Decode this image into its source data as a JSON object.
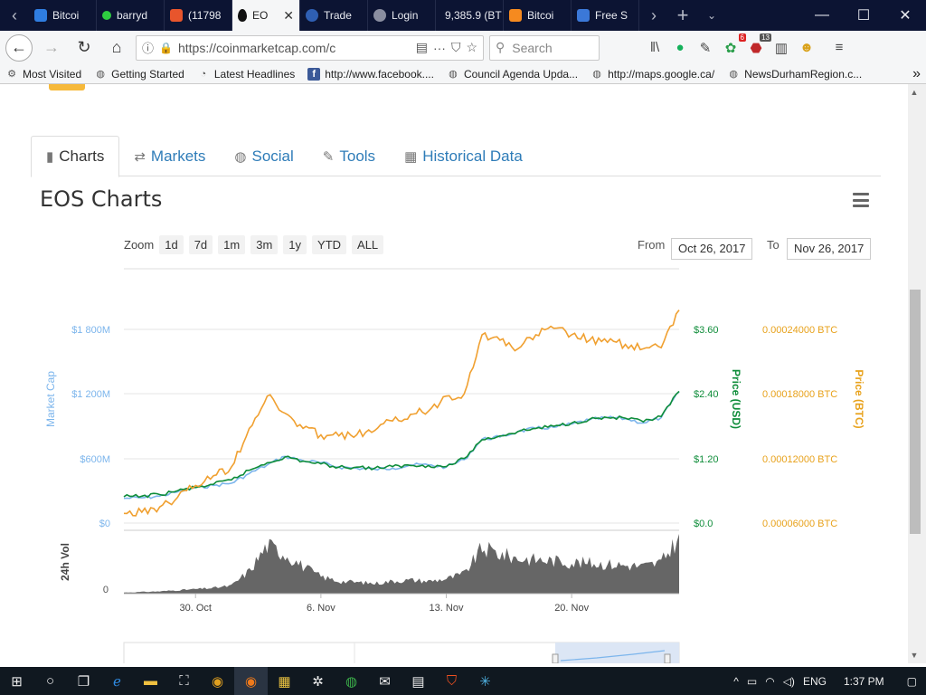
{
  "browser": {
    "tabs": [
      {
        "label": "Bitcoi",
        "icon": "wallet-icon",
        "color": "#2f7de1"
      },
      {
        "label": "barryd",
        "icon": "status-dot-icon",
        "color": "#2ecc40"
      },
      {
        "label": "(11798",
        "icon": "chat-icon",
        "color": "#e8552c"
      },
      {
        "label": "EO",
        "icon": "eos-icon",
        "color": "#111111",
        "active": true
      },
      {
        "label": "Trade",
        "icon": "coin-icon",
        "color": "#2f5fb3"
      },
      {
        "label": "Login",
        "icon": "lock-icon",
        "color": "#8a8ea0"
      },
      {
        "label": "9,385.9 (BT",
        "icon": "",
        "color": ""
      },
      {
        "label": "Bitcoi",
        "icon": "chart-icon",
        "color": "#f58a1f"
      },
      {
        "label": "Free S",
        "icon": "mail-icon",
        "color": "#3b78d8"
      }
    ],
    "url": "https://coinmarketcap.com/c",
    "search_placeholder": "Search",
    "badges": {
      "extension_a": "6",
      "extension_b": "13"
    },
    "bookmarks": [
      {
        "label": "Most Visited",
        "icon": "gear-icon"
      },
      {
        "label": "Getting Started",
        "icon": "globe-icon"
      },
      {
        "label": "Latest Headlines",
        "icon": "rss-icon"
      },
      {
        "label": "http://www.facebook....",
        "icon": "facebook-icon"
      },
      {
        "label": "Council Agenda Upda...",
        "icon": "globe-icon"
      },
      {
        "label": "http://maps.google.ca/",
        "icon": "globe-icon"
      },
      {
        "label": "NewsDurhamRegion.c...",
        "icon": "globe-icon"
      }
    ]
  },
  "page": {
    "tabs": [
      {
        "label": "Charts",
        "icon": "bar-chart-icon",
        "active": true
      },
      {
        "label": "Markets",
        "icon": "exchange-icon"
      },
      {
        "label": "Social",
        "icon": "globe-icon"
      },
      {
        "label": "Tools",
        "icon": "wrench-icon"
      },
      {
        "label": "Historical Data",
        "icon": "calendar-icon"
      }
    ],
    "chart_title": "EOS Charts",
    "zoom_label": "Zoom",
    "zoom_options": [
      "1d",
      "7d",
      "1m",
      "3m",
      "1y",
      "YTD",
      "ALL"
    ],
    "from_label": "From",
    "from_date": "Oct 26, 2017",
    "to_label": "To",
    "to_date": "Nov 26, 2017"
  },
  "chart_data": {
    "type": "line",
    "title": "EOS Charts",
    "x": [
      "Oct 26",
      "Oct 27",
      "Oct 28",
      "Oct 29",
      "Oct 30",
      "Oct 31",
      "Nov 1",
      "Nov 2",
      "Nov 3",
      "Nov 4",
      "Nov 5",
      "Nov 6",
      "Nov 7",
      "Nov 8",
      "Nov 9",
      "Nov 10",
      "Nov 11",
      "Nov 12",
      "Nov 13",
      "Nov 14",
      "Nov 15",
      "Nov 16",
      "Nov 17",
      "Nov 18",
      "Nov 19",
      "Nov 20",
      "Nov 21",
      "Nov 22",
      "Nov 23",
      "Nov 24",
      "Nov 25",
      "Nov 26"
    ],
    "x_tick_labels": [
      "30. Oct",
      "6. Nov",
      "13. Nov",
      "20. Nov"
    ],
    "y_axes": [
      {
        "name": "Market Cap",
        "ticks": [
          "$0",
          "$600M",
          "$1 200M",
          "$1 800M"
        ],
        "color": "#7cb5ec",
        "range": [
          0,
          1800
        ]
      },
      {
        "name": "Price (USD)",
        "ticks": [
          "$0.0",
          "$1.20",
          "$2.40",
          "$3.60"
        ],
        "color": "#0f8d3a",
        "range": [
          0,
          3.6
        ]
      },
      {
        "name": "Price (BTC)",
        "ticks": [
          "0.00006000 BTC",
          "0.00012000 BTC",
          "0.00018000 BTC",
          "0.00024000 BTC"
        ],
        "color": "#e8a21c",
        "range": [
          6e-05,
          0.00024
        ]
      }
    ],
    "series": [
      {
        "name": "Market Cap",
        "axis": 0,
        "color": "#7cb5ec",
        "values": [
          230,
          235,
          250,
          290,
          330,
          350,
          370,
          460,
          540,
          620,
          580,
          560,
          520,
          510,
          500,
          510,
          540,
          540,
          520,
          590,
          780,
          800,
          850,
          880,
          890,
          920,
          960,
          980,
          970,
          930,
          980,
          1220
        ]
      },
      {
        "name": "Price (USD)",
        "axis": 1,
        "color": "#0f8d3a",
        "values": [
          0.49,
          0.5,
          0.53,
          0.6,
          0.66,
          0.72,
          0.8,
          0.98,
          1.12,
          1.23,
          1.15,
          1.1,
          1.04,
          1.04,
          1.02,
          1.05,
          1.07,
          1.07,
          1.05,
          1.2,
          1.55,
          1.62,
          1.7,
          1.76,
          1.8,
          1.86,
          1.93,
          1.96,
          1.95,
          1.88,
          1.98,
          2.45
        ]
      },
      {
        "name": "Price (BTC)",
        "axis": 2,
        "color": "#f0a030",
        "values": [
          6.9e-05,
          7e-05,
          7.5e-05,
          8.4e-05,
          9.5e-05,
          0.000104,
          0.000112,
          0.000148,
          0.000178,
          0.000162,
          0.000148,
          0.000142,
          0.000141,
          0.000142,
          0.000146,
          0.000155,
          0.000161,
          0.000164,
          0.000178,
          0.00018,
          0.000235,
          0.00023,
          0.000222,
          0.000235,
          0.000241,
          0.000235,
          0.00023,
          0.000228,
          0.000226,
          0.000222,
          0.000223,
          0.000258
        ]
      }
    ],
    "volume": {
      "name": "24h Vol",
      "tick": "0",
      "color": "#666666",
      "values": [
        2,
        3,
        4,
        6,
        8,
        10,
        14,
        40,
        85,
        70,
        48,
        30,
        22,
        20,
        18,
        22,
        24,
        22,
        26,
        35,
        80,
        70,
        62,
        60,
        58,
        55,
        54,
        52,
        50,
        48,
        55,
        100
      ]
    },
    "grid": true
  },
  "taskbar": {
    "items": [
      "windows-icon",
      "cortana-icon",
      "task-view-icon",
      "edge-icon",
      "explorer-icon",
      "store-icon",
      "chrome-icon",
      "firefox-icon",
      "calculator-grid-icon",
      "settings-icon",
      "globe-icon",
      "mail-icon",
      "calculator-icon",
      "brave-icon",
      "app-icon"
    ],
    "lang": "ENG",
    "time": "1:37 PM"
  }
}
